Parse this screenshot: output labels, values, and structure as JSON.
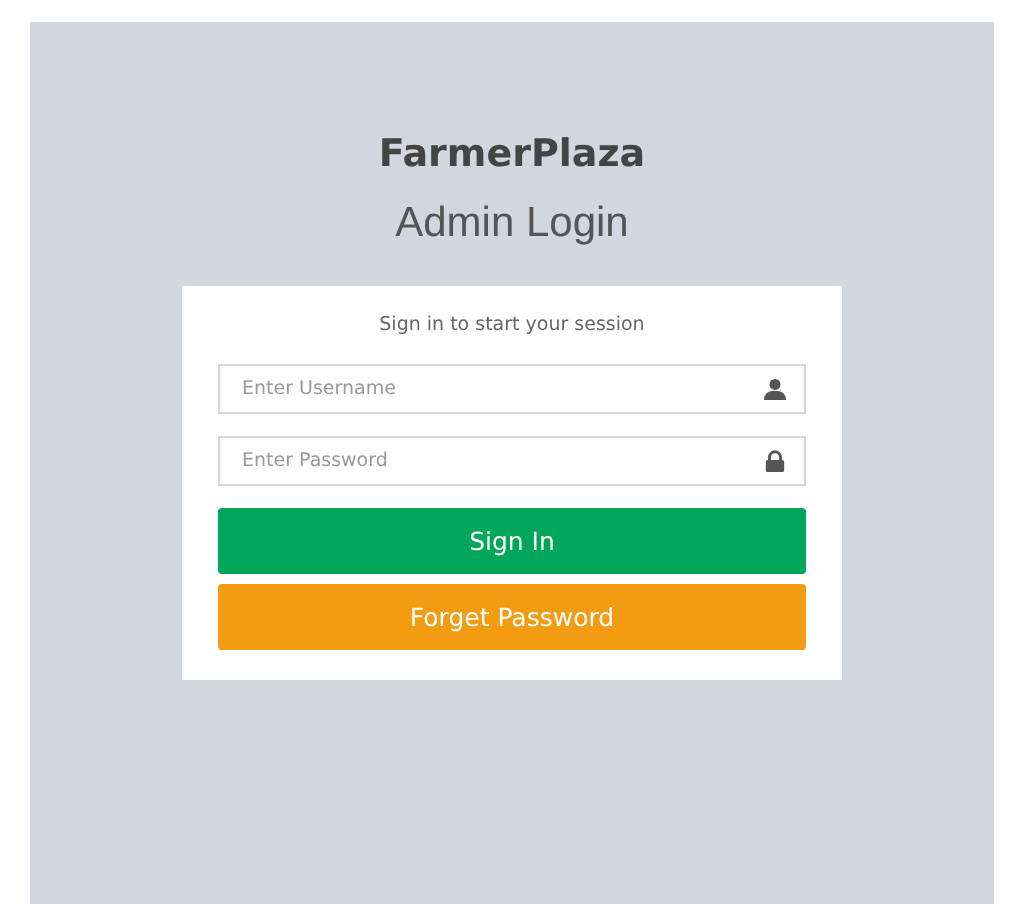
{
  "brand": "FarmerPlaza",
  "heading": "Admin Login",
  "form": {
    "prompt": "Sign in to start your session",
    "fields": [
      {
        "placeholder": "Enter Username",
        "kind": "user"
      },
      {
        "placeholder": "Enter Password",
        "kind": "lock"
      }
    ],
    "buttons": [
      {
        "label": "Sign In",
        "kind": "primary"
      },
      {
        "label": "Forget Password",
        "kind": "warning"
      }
    ]
  }
}
